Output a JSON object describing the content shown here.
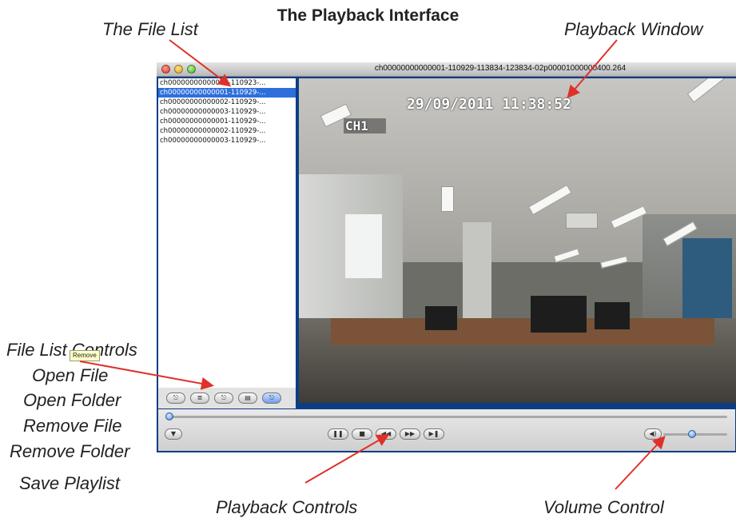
{
  "heading": "The Playback Interface",
  "annotations": {
    "file_list": "The File List",
    "playback_window": "Playback Window",
    "file_list_controls": "File List Controls",
    "open_file": "Open File",
    "open_folder": "Open Folder",
    "remove_file": "Remove File",
    "remove_folder": "Remove Folder",
    "save_playlist": "Save Playlist",
    "playback_controls": "Playback Controls",
    "volume_control": "Volume Control"
  },
  "window": {
    "title": "ch00000000000001-110929-113834-123834-02p00001000000400.264"
  },
  "file_list": {
    "selected_index": 1,
    "items": [
      "ch00000000000001-110923-...",
      "ch00000000000001-110929-...",
      "ch00000000000002-110929-...",
      "ch00000000000003-110929-...",
      "ch00000000000001-110929-...",
      "ch00000000000002-110929-...",
      "ch00000000000003-110929-..."
    ]
  },
  "video": {
    "timestamp": "29/09/2011 11:38:52",
    "channel": "CH1"
  },
  "file_list_controls": {
    "tooltip": "Remove",
    "buttons": [
      {
        "name": "open-file-button",
        "icon": "open-file-icon",
        "glyph": "⎋"
      },
      {
        "name": "open-folder-button",
        "icon": "list-icon",
        "glyph": "≣"
      },
      {
        "name": "remove-file-button",
        "icon": "remove-file-icon",
        "glyph": "⎋"
      },
      {
        "name": "remove-folder-button",
        "icon": "remove-folder-icon",
        "glyph": "▤"
      },
      {
        "name": "save-playlist-button",
        "icon": "save-icon",
        "glyph": "⎋"
      }
    ]
  },
  "playback": {
    "progress": 0.0,
    "buttons": [
      {
        "name": "pause-button",
        "icon": "pause-icon",
        "glyph": "❚❚"
      },
      {
        "name": "stop-button",
        "icon": "stop-icon",
        "glyph": "■"
      },
      {
        "name": "rewind-button",
        "icon": "rewind-icon",
        "glyph": "◀◀"
      },
      {
        "name": "fast-forward-button",
        "icon": "fast-forward-icon",
        "glyph": "▶▶"
      },
      {
        "name": "next-frame-button",
        "icon": "step-forward-icon",
        "glyph": "▶❚"
      }
    ],
    "snapshot_icon": "camera-icon",
    "snapshot_glyph": "▼"
  },
  "volume": {
    "level": 0.45,
    "icon": "speaker-icon",
    "glyph": "◀)"
  },
  "colors": {
    "window_frame": "#0b3e85",
    "selection": "#2f6fdc",
    "arrow": "#e0302a"
  }
}
